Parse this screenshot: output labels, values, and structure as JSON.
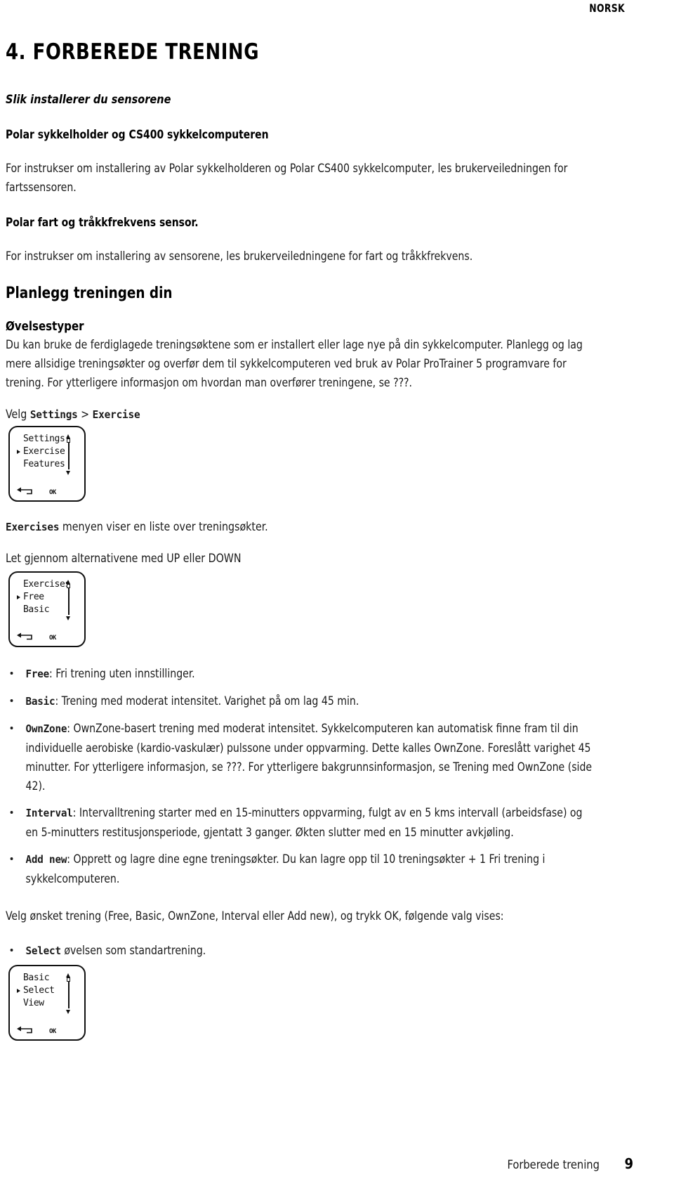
{
  "header": {
    "language_tag": "NORSK"
  },
  "chapter": {
    "title": "4. FORBEREDE TRENING"
  },
  "sections": {
    "install_heading": "Slik installerer du sensorene",
    "bike_mount_heading": "Polar sykkelholder og CS400 sykkelcomputeren",
    "bike_mount_body": "For instrukser om installering av Polar sykkelholderen og Polar CS400 sykkelcomputer, les brukerveiledningen for fartssensoren.",
    "speed_cadence_heading": "Polar fart og tråkkfrekvens sensor.",
    "speed_cadence_body": "For instrukser om installering av sensorene, les brukerveiledningene for fart og tråkkfrekvens.",
    "plan_heading": "Planlegg treningen din",
    "exercise_types_heading": "Øvelsestyper",
    "exercise_types_body": "Du kan bruke de ferdiglagede treningsøktene som er installert eller lage nye på din sykkelcomputer. Planlegg og lag mere allsidige treningsøkter og overfør dem til sykkelcomputeren ved bruk av Polar ProTrainer 5 programvare for trening. For ytterligere informasjon om hvordan man overfører treningene, se ???."
  },
  "nav_path": {
    "prefix": "Velg ",
    "first": "Settings",
    "separator": " > ",
    "second": "Exercise"
  },
  "lcd_settings": {
    "rows": [
      {
        "label": "Settings",
        "selected": false
      },
      {
        "label": "Exercise",
        "selected": true
      },
      {
        "label": "Features",
        "selected": false
      }
    ],
    "ok_label": "OK"
  },
  "exercises_intro": {
    "bold": "Exercises",
    "rest": " menyen viser en liste over treningsøkter."
  },
  "browse_hint": "Let gjennom alternativene med UP eller DOWN",
  "lcd_exercises": {
    "rows": [
      {
        "label": "Exercises",
        "selected": false
      },
      {
        "label": "Free",
        "selected": true
      },
      {
        "label": "Basic",
        "selected": false
      }
    ],
    "ok_label": "OK"
  },
  "exercise_list": [
    {
      "term": "Free",
      "sep": ": ",
      "text": "Fri trening uten innstillinger."
    },
    {
      "term": "Basic",
      "sep": ": ",
      "text": "Trening med moderat intensitet. Varighet på om lag 45 min."
    },
    {
      "term": "OwnZone",
      "sep": ": ",
      "text": "OwnZone-basert trening med moderat intensitet. Sykkelcomputeren kan automatisk finne fram til din individuelle aerobiske (kardio-vaskulær) pulssone under oppvarming. Dette kalles OwnZone. Foreslått varighet 45 minutter. For ytterligere informasjon, se ???. For ytterligere bakgrunnsinformasjon, se Trening med OwnZone (side 42)."
    },
    {
      "term": "Interval",
      "sep": ": ",
      "text": "Intervalltrening starter med en 15-minutters oppvarming, fulgt av en 5 kms intervall (arbeidsfase) og en 5-minutters restitusjonsperiode, gjentatt 3 ganger. Økten slutter med en 15 minutter avkjøling."
    },
    {
      "term": "Add new",
      "sep": ": ",
      "text": "Opprett og lagre dine egne treningsøkter. Du kan lagre opp til 10 treningsøkter + 1 Fri trening i sykkelcomputeren."
    }
  ],
  "closing_paragraph": "Velg ønsket trening (Free, Basic, OwnZone, Interval eller Add new), og trykk OK, følgende valg vises:",
  "select_bullet": {
    "term": "Select",
    "text": " øvelsen som standartrening."
  },
  "lcd_basic": {
    "rows": [
      {
        "label": "Basic",
        "selected": false
      },
      {
        "label": "Select",
        "selected": true
      },
      {
        "label": "View",
        "selected": false
      }
    ],
    "ok_label": "OK"
  },
  "footer": {
    "title": "Forberede trening",
    "page_number": "9"
  },
  "colors": {
    "text": "#1a1a1a",
    "heading": "#000000",
    "background": "#ffffff"
  }
}
